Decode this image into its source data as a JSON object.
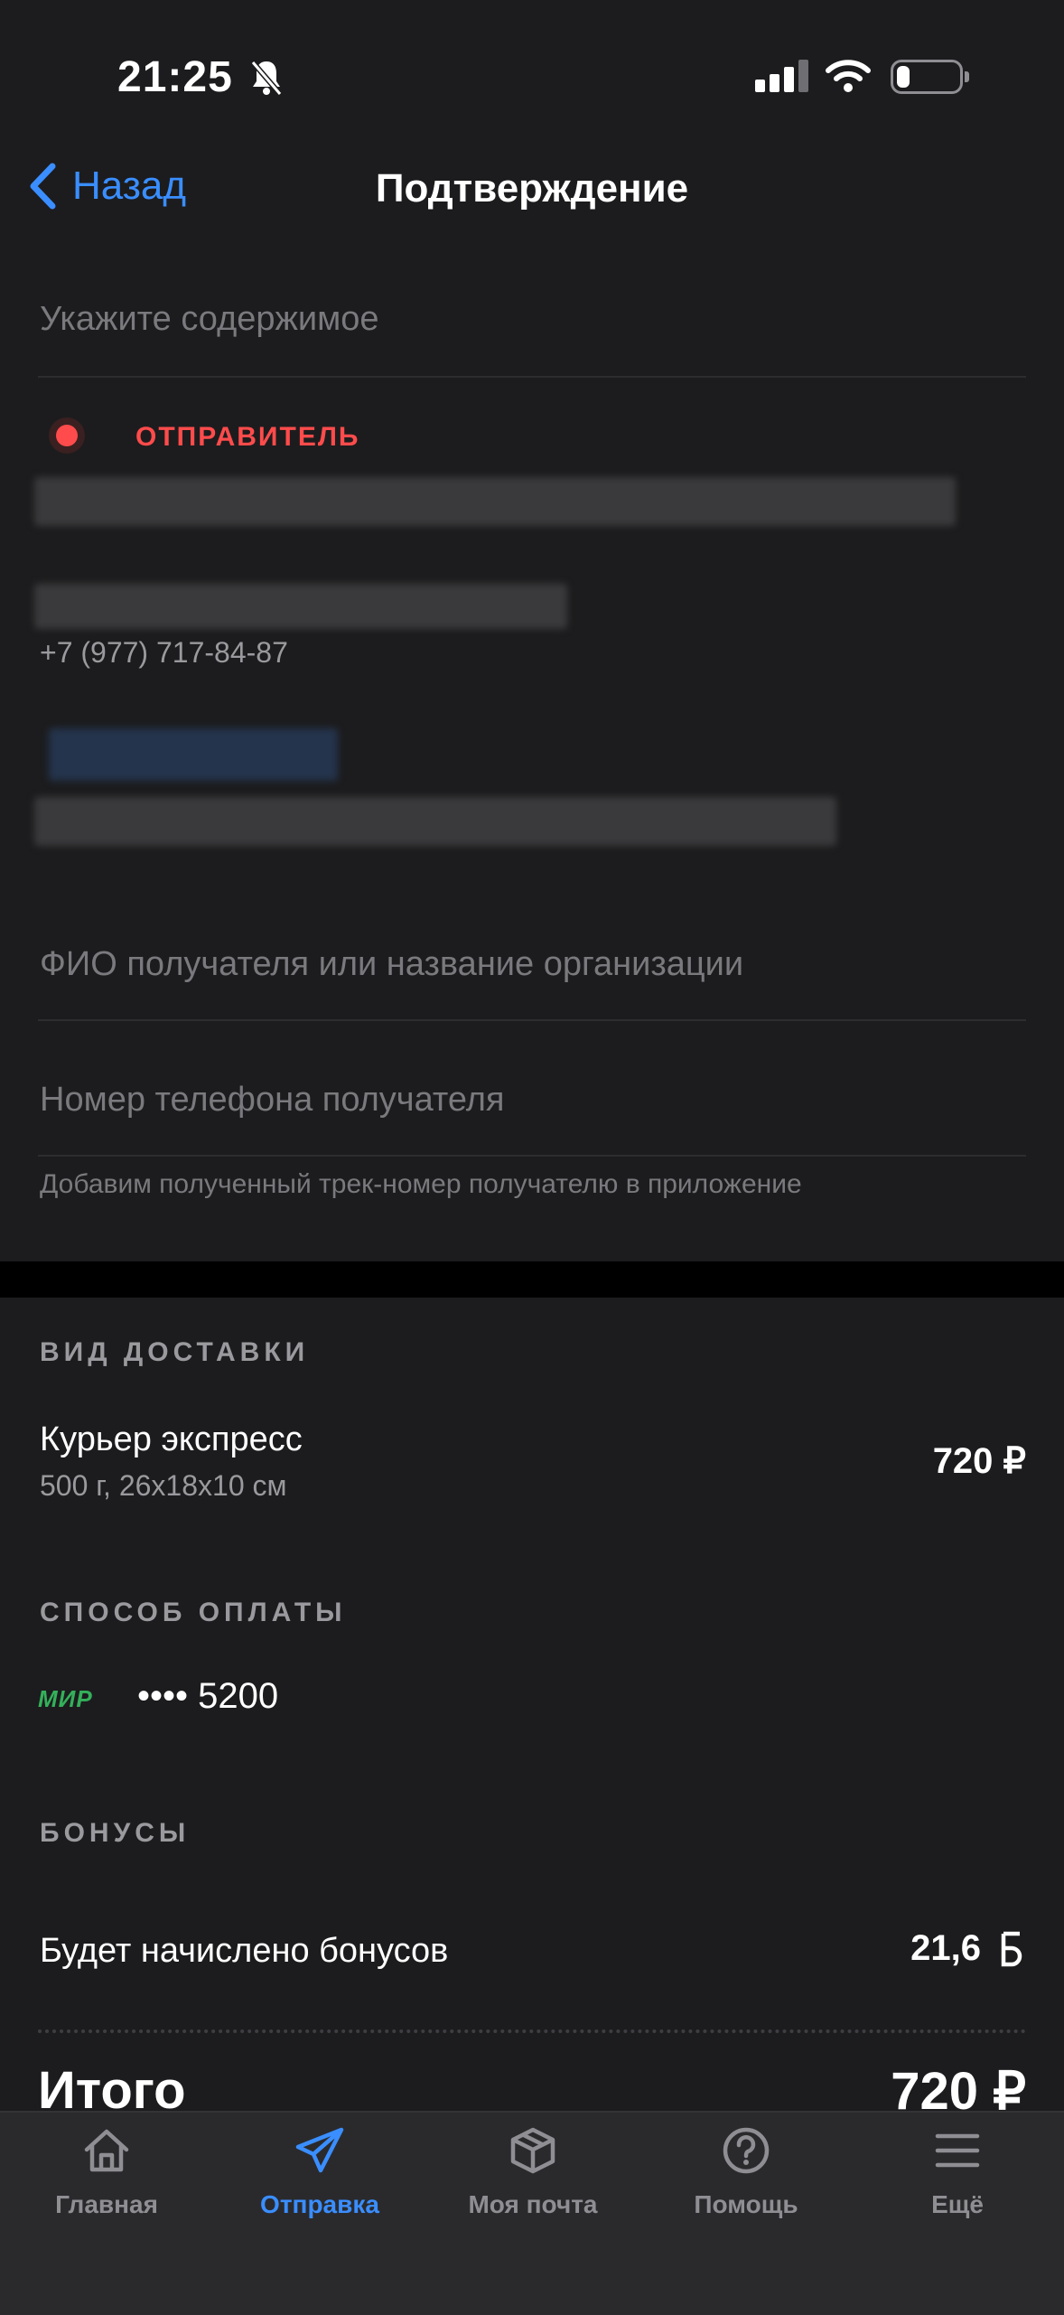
{
  "status_bar": {
    "time": "21:25"
  },
  "nav": {
    "back_label": "Назад",
    "title": "Подтверждение"
  },
  "form": {
    "contents_placeholder": "Укажите содержимое",
    "recipient_name_placeholder": "ФИО получателя или название организации",
    "recipient_phone_placeholder": "Номер телефона получателя",
    "hint": "Добавим полученный трек-номер получателю в приложение"
  },
  "sender": {
    "label": "ОТПРАВИТЕЛЬ",
    "phone": "+7 (977) 717-84-87"
  },
  "delivery": {
    "header": "ВИД ДОСТАВКИ",
    "name": "Курьер экспресс",
    "details": "500 г, 26x18x10 см",
    "price": "720 ₽"
  },
  "payment": {
    "header": "СПОСОБ ОПЛАТЫ",
    "brand": "МИР",
    "card_mask": "•••• 5200"
  },
  "bonuses": {
    "header": "БОНУСЫ",
    "label": "Будет начислено бонусов",
    "value": "21,6"
  },
  "total": {
    "label": "Итого",
    "value": "720 ₽"
  },
  "tabs": [
    {
      "label": "Главная",
      "icon": "home-icon"
    },
    {
      "label": "Отправка",
      "icon": "send-icon",
      "active": true
    },
    {
      "label": "Моя почта",
      "icon": "box-icon"
    },
    {
      "label": "Помощь",
      "icon": "help-icon"
    },
    {
      "label": "Ещё",
      "icon": "menu-icon"
    }
  ],
  "colors": {
    "accent": "#3a8eff",
    "sender": "#ff4b4b",
    "mir": "#34b05a",
    "background": "#1c1c1e"
  }
}
